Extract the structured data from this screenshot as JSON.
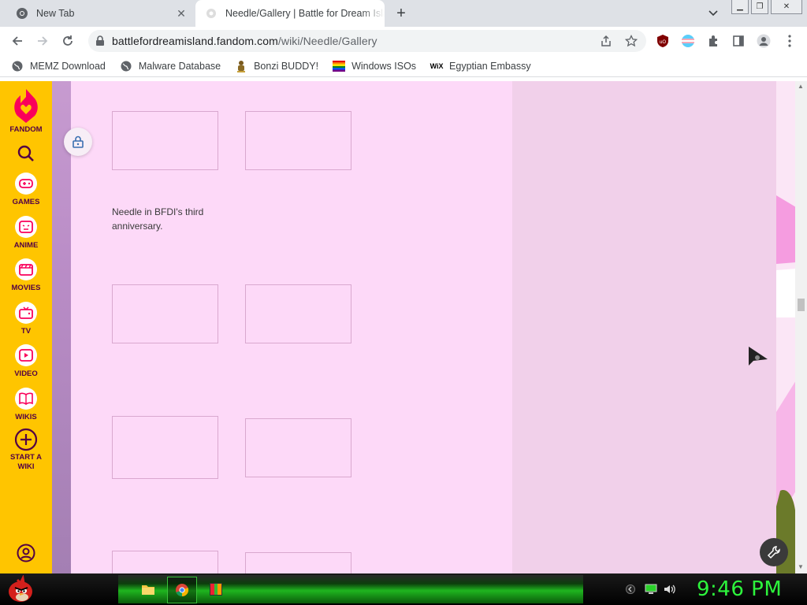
{
  "browser": {
    "tabs": [
      {
        "title": "New Tab",
        "active": false
      },
      {
        "title": "Needle/Gallery | Battle for Dream Island Wiki | Fandom",
        "active": true
      }
    ],
    "url_host": "battlefordreamisland.fandom.com",
    "url_path": "/wiki/Needle/Gallery",
    "bookmarks": [
      {
        "label": "MEMZ Download",
        "icon": "globe-icon"
      },
      {
        "label": "Malware Database",
        "icon": "globe-icon"
      },
      {
        "label": "Bonzi BUDDY!",
        "icon": "bonzi-icon"
      },
      {
        "label": "Windows ISOs",
        "icon": "rainbow-flag-icon"
      },
      {
        "label": "Egyptian Embassy",
        "icon": "wix-icon"
      }
    ]
  },
  "sidebar": {
    "brand": "FANDOM",
    "items": [
      {
        "label": "GAMES",
        "icon": "gamepad-icon"
      },
      {
        "label": "ANIME",
        "icon": "anime-icon"
      },
      {
        "label": "MOVIES",
        "icon": "clapper-icon"
      },
      {
        "label": "TV",
        "icon": "tv-icon"
      },
      {
        "label": "VIDEO",
        "icon": "play-icon"
      },
      {
        "label": "WIKIS",
        "icon": "book-icon"
      }
    ],
    "start_wiki": "START A WIKI"
  },
  "gallery": {
    "caption": "Needle in BFDI's third anniversary."
  },
  "taskbar": {
    "clock": "9:46 PM"
  },
  "colors": {
    "fandom_yellow": "#ffc500",
    "fandom_pink": "#fa005a",
    "page_bg": "#fdd9f8",
    "clock_green": "#2df53c"
  }
}
